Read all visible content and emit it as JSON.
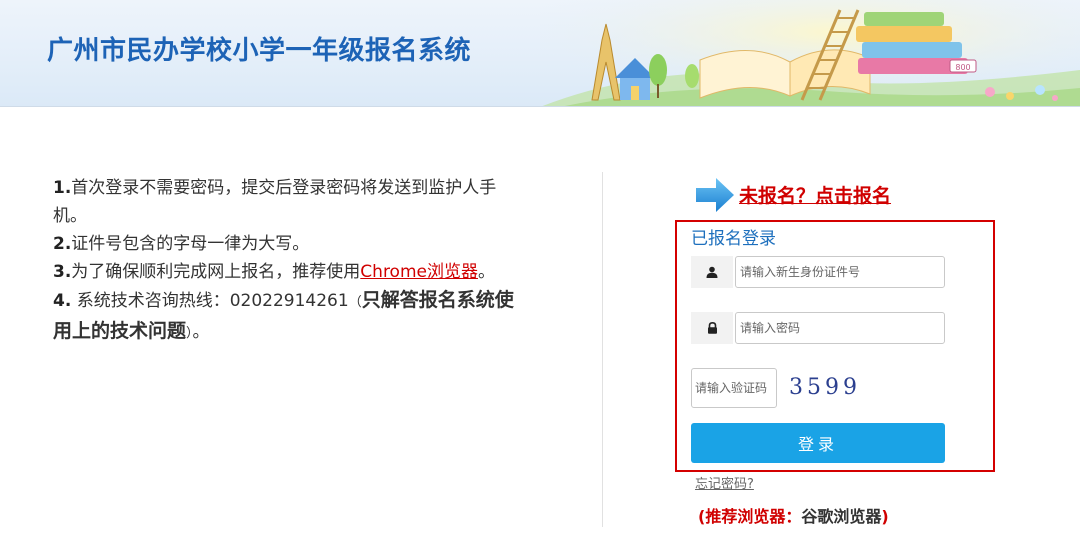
{
  "header": {
    "title": "广州市民办学校小学一年级报名系统",
    "illustration_book_label": "800"
  },
  "notice": {
    "item1_num": "1.",
    "item1_text": "首次登录不需要密码，提交后登录密码将发送到监护人手机。",
    "item2_num": "2.",
    "item2_text": "证件号包含的字母一律为大写。",
    "item3_num": "3.",
    "item3_text": "为了确保顺利完成网上报名，推荐使用",
    "item3_link": "Chrome浏览器",
    "item3_end": "。",
    "item4_num": "4.",
    "item4_text": " 系统技术咨询热线：02022914261",
    "item4_open": "（",
    "item4_bold": "只解答报名系统使用上的技术问题",
    "item4_close": "）",
    "item4_end": "。"
  },
  "register": {
    "link_text": "未报名？点击报名"
  },
  "login": {
    "title": "已报名登录",
    "id_placeholder": "请输入新生身份证件号",
    "password_placeholder": "请输入密码",
    "captcha_placeholder": "请输入验证码",
    "captcha_code": "3599",
    "button_label": "登录",
    "forgot_link": "忘记密码?"
  },
  "browser_tip": {
    "open": "(",
    "label": "推荐浏览器：",
    "value": "谷歌浏览器",
    "close": ")"
  },
  "colors": {
    "title_blue": "#1d63b6",
    "accent_red": "#d00000",
    "button_blue": "#1aa3e6",
    "login_title_blue": "#1d6fbd"
  }
}
